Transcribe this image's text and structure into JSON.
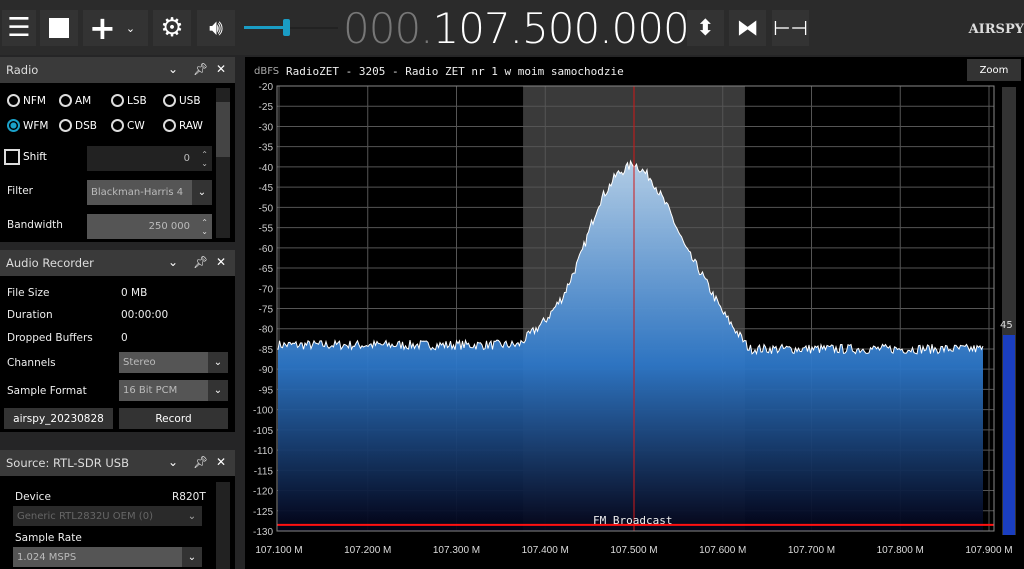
{
  "toolbar": {
    "frequency_dim": "000.",
    "frequency": "107.500.000",
    "logo": "AIRSPY",
    "volume_percent": 45,
    "icons": [
      "menu-icon",
      "stop-icon",
      "add-icon",
      "chevron-down-icon",
      "gear-icon",
      "speaker-icon",
      "tune-arrows-icon",
      "center-icon",
      "span-icon"
    ]
  },
  "radio_panel": {
    "title": "Radio",
    "modes": [
      {
        "label": "NFM",
        "selected": false
      },
      {
        "label": "AM",
        "selected": false
      },
      {
        "label": "LSB",
        "selected": false
      },
      {
        "label": "USB",
        "selected": false
      },
      {
        "label": "WFM",
        "selected": true
      },
      {
        "label": "DSB",
        "selected": false
      },
      {
        "label": "CW",
        "selected": false
      },
      {
        "label": "RAW",
        "selected": false
      }
    ],
    "shift_label": "Shift",
    "shift_value": "0",
    "filter_label": "Filter",
    "filter_value": "Blackman-Harris 4",
    "bandwidth_label": "Bandwidth",
    "bandwidth_value": "250 000"
  },
  "recorder_panel": {
    "title": "Audio Recorder",
    "file_size_label": "File Size",
    "file_size": "0 MB",
    "duration_label": "Duration",
    "duration": "00:00:00",
    "dropped_label": "Dropped Buffers",
    "dropped": "0",
    "channels_label": "Channels",
    "channels": "Stereo",
    "format_label": "Sample Format",
    "format": "16 Bit PCM",
    "file_button": "airspy_20230828",
    "record_button": "Record"
  },
  "source_panel": {
    "title": "Source: RTL-SDR USB",
    "device_label": "Device",
    "tuner": "R820T",
    "device": "Generic RTL2832U OEM (0)",
    "rate_label": "Sample Rate",
    "rate": "1.024 MSPS"
  },
  "spectrum": {
    "unit": "dBFS",
    "station": "RadioZET - 3205 - Radio ZET nr 1 w moim samochodzie",
    "zoom_button": "Zoom",
    "band_label": "FM Broadcast",
    "gain_value": "45",
    "y_ticks": [
      -20,
      -25,
      -30,
      -35,
      -40,
      -45,
      -50,
      -55,
      -60,
      -65,
      -70,
      -75,
      -80,
      -85,
      -90,
      -95,
      -100,
      -105,
      -110,
      -115,
      -120,
      -125,
      -130
    ],
    "x_ticks": [
      "107.100 M",
      "107.200 M",
      "107.300 M",
      "107.400 M",
      "107.500 M",
      "107.600 M",
      "107.700 M",
      "107.800 M",
      "107.900 M"
    ],
    "x_range_mhz": [
      107.1,
      107.9
    ],
    "y_range_dbfs": [
      -130,
      -20
    ],
    "center_mhz": 107.5,
    "filter_mhz": [
      107.375,
      107.625
    ],
    "squelch_dbfs": -128.5,
    "trace": [
      [
        107.095,
        -84
      ],
      [
        107.37,
        -84
      ],
      [
        107.38,
        -82
      ],
      [
        107.4,
        -78
      ],
      [
        107.42,
        -72
      ],
      [
        107.44,
        -62
      ],
      [
        107.46,
        -49
      ],
      [
        107.48,
        -42
      ],
      [
        107.5,
        -39
      ],
      [
        107.52,
        -43
      ],
      [
        107.54,
        -51
      ],
      [
        107.56,
        -61
      ],
      [
        107.575,
        -66
      ],
      [
        107.6,
        -76
      ],
      [
        107.62,
        -82
      ],
      [
        107.63,
        -85
      ],
      [
        107.905,
        -85
      ]
    ],
    "colors": {
      "fill_top": "#2d77c8",
      "fill_bottom": "#020216",
      "center_line": "#d01818",
      "squelch": "#ff1010",
      "filter_band": "#3a3a3a",
      "gain_bar": "#1a3ec0"
    }
  }
}
